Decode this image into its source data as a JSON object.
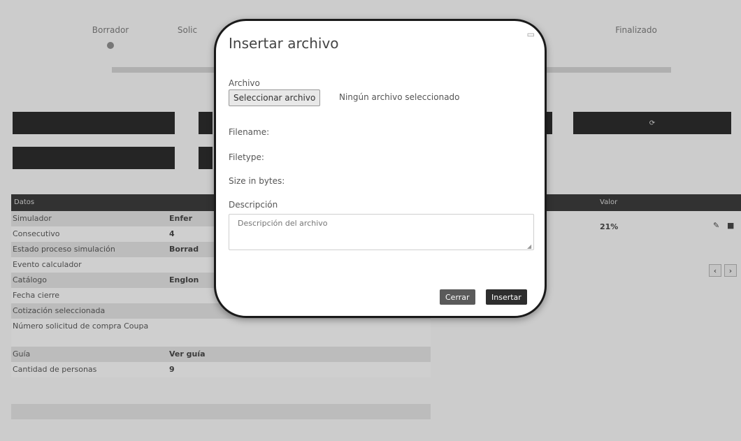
{
  "steps": [
    {
      "label": "Borrador"
    },
    {
      "label": "Solic"
    },
    {
      "label": "Finalizado"
    }
  ],
  "table": {
    "header": {
      "col1": "Datos",
      "col2": "Valor"
    },
    "rows": [
      {
        "key": "Simulador",
        "value": "Enfer"
      },
      {
        "key": "Consecutivo",
        "value": "4"
      },
      {
        "key": "Estado proceso simulación",
        "value": "Borrad"
      },
      {
        "key": "Evento calculador",
        "value": ""
      },
      {
        "key": "Catálogo",
        "value": "Englon"
      },
      {
        "key": "Fecha cierre",
        "value": ""
      },
      {
        "key": "Cotización seleccionada",
        "value": ""
      },
      {
        "key": "Número solicitud de compra Coupa",
        "value": ""
      },
      {
        "key": "Guía",
        "value": "Ver guía"
      },
      {
        "key": "Cantidad de personas",
        "value": "9"
      }
    ],
    "right_value": "21%",
    "pager": {
      "prev": "‹",
      "next": "›"
    }
  },
  "modal": {
    "title": "Insertar archivo",
    "archivo_label": "Archivo",
    "file_button": "Seleccionar archivo",
    "file_status": "Ningún archivo seleccionado",
    "filename_label": "Filename:",
    "filetype_label": "Filetype:",
    "size_label": "Size in bytes:",
    "description_label": "Descripción",
    "description_placeholder": "Descripción del archivo",
    "close_button": "Cerrar",
    "insert_button": "Insertar"
  },
  "colors": {
    "modal_bg": "#ffffff",
    "insert_btn": "#2e2e2e",
    "close_btn": "#5a5a5a",
    "table_header": "#3a3a3a"
  }
}
